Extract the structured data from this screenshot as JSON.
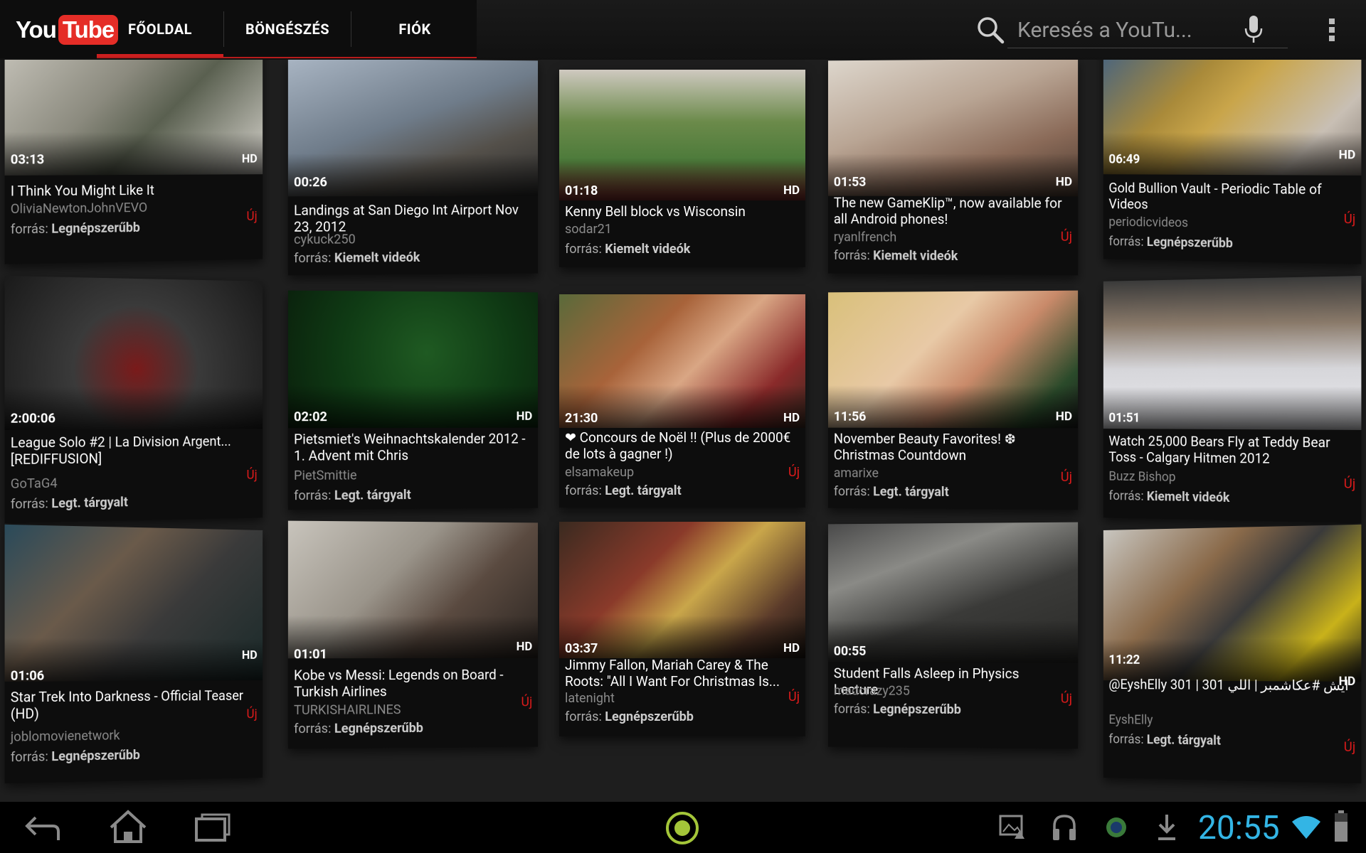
{
  "app": {
    "logo_you": "You",
    "logo_tube": "Tube"
  },
  "tabs": [
    {
      "label": "FŐOLDAL",
      "active": true
    },
    {
      "label": "BÖNGÉSZÉS",
      "active": false
    },
    {
      "label": "FIÓK",
      "active": false
    }
  ],
  "search": {
    "placeholder": "Keresés a YouTu..."
  },
  "videos": [
    {
      "duration": "03:13",
      "hd": "HD",
      "title": "I Think You Might Like It",
      "channel": "OliviaNewtonJohnVEVO",
      "source_prefix": "forrás:",
      "source": "Legnépszerűbb",
      "new": "Új"
    },
    {
      "duration": "00:26",
      "hd": "",
      "title": "Landings at San Diego Int Airport Nov 23, 2012",
      "channel": "cykuck250",
      "source_prefix": "forrás:",
      "source": "Kiemelt videók",
      "new": ""
    },
    {
      "duration": "01:18",
      "hd": "HD",
      "title": "Kenny Bell block vs Wisconsin",
      "channel": "sodar21",
      "source_prefix": "forrás:",
      "source": "Kiemelt videók",
      "new": ""
    },
    {
      "duration": "01:53",
      "hd": "HD",
      "title": "The new GameKlip™, now available for all Android phones!",
      "channel": "ryanlfrench",
      "source_prefix": "forrás:",
      "source": "Kiemelt videók",
      "new": "Új"
    },
    {
      "duration": "06:49",
      "hd": "HD",
      "title": "Gold Bullion Vault - Periodic Table of Videos",
      "channel": "periodicvideos",
      "source_prefix": "forrás:",
      "source": "Legnépszerűbb",
      "new": "Új"
    },
    {
      "duration": "2:00:06",
      "hd": "",
      "title": "League Solo #2 | La Division Argent... [REDIFFUSION]",
      "channel": "GoTaG4",
      "source_prefix": "forrás:",
      "source": "Legt. tárgyalt",
      "new": "Új"
    },
    {
      "duration": "02:02",
      "hd": "HD",
      "title": "Pietsmiet's Weihnachtskalender 2012 - 1. Advent mit Chris",
      "channel": "PietSmittie",
      "source_prefix": "forrás:",
      "source": "Legt. tárgyalt",
      "new": ""
    },
    {
      "duration": "21:30",
      "hd": "HD",
      "title": "❤ Concours de Noël !! (Plus de 2000€ de lots à gagner !)",
      "channel": "elsamakeup",
      "source_prefix": "forrás:",
      "source": "Legt. tárgyalt",
      "new": "Új"
    },
    {
      "duration": "11:56",
      "hd": "HD",
      "title": "November Beauty Favorites! ❆ Christmas Countdown",
      "channel": "amarixe",
      "source_prefix": "forrás:",
      "source": "Legt. tárgyalt",
      "new": "Új"
    },
    {
      "duration": "01:51",
      "hd": "",
      "title": "Watch 25,000 Bears Fly at Teddy Bear Toss - Calgary Hitmen 2012",
      "channel": "Buzz Bishop",
      "source_prefix": "forrás:",
      "source": "Kiemelt videók",
      "new": "Új"
    },
    {
      "duration": "01:06",
      "hd": "HD",
      "title": "Star Trek Into Darkness - Official Teaser (HD)",
      "channel": "joblomovienetwork",
      "source_prefix": "forrás:",
      "source": "Legnépszerűbb",
      "new": "Új"
    },
    {
      "duration": "01:01",
      "hd": "HD",
      "title": "Kobe vs Messi: Legends on Board - Turkish Airlines",
      "channel": "TURKISHAIRLINES",
      "source_prefix": "forrás:",
      "source": "Legnépszerűbb",
      "new": "Új"
    },
    {
      "duration": "03:37",
      "hd": "HD",
      "title": "Jimmy Fallon, Mariah Carey & The Roots: \"All I Want For Christmas Is...",
      "channel": "latenight",
      "source_prefix": "forrás:",
      "source": "Legnépszerűbb",
      "new": "Új"
    },
    {
      "duration": "00:55",
      "hd": "",
      "title": "Student Falls Asleep in Physics Lecture",
      "channel": "madcrazy235",
      "source_prefix": "forrás:",
      "source": "Legnépszerűbb",
      "new": "Új"
    },
    {
      "duration": "11:22",
      "hd": "HD",
      "title": "@EyshElly 301 | 301 ايش #عكاشمبر | اللي",
      "channel": "EyshElly",
      "source_prefix": "forrás:",
      "source": "Legt. tárgyalt",
      "new": "Új"
    }
  ],
  "status": {
    "clock": "20:55"
  },
  "colors": {
    "accent_red": "#cc1f1f",
    "new_red": "#e01b1b",
    "clock_blue": "#33b5e5"
  }
}
